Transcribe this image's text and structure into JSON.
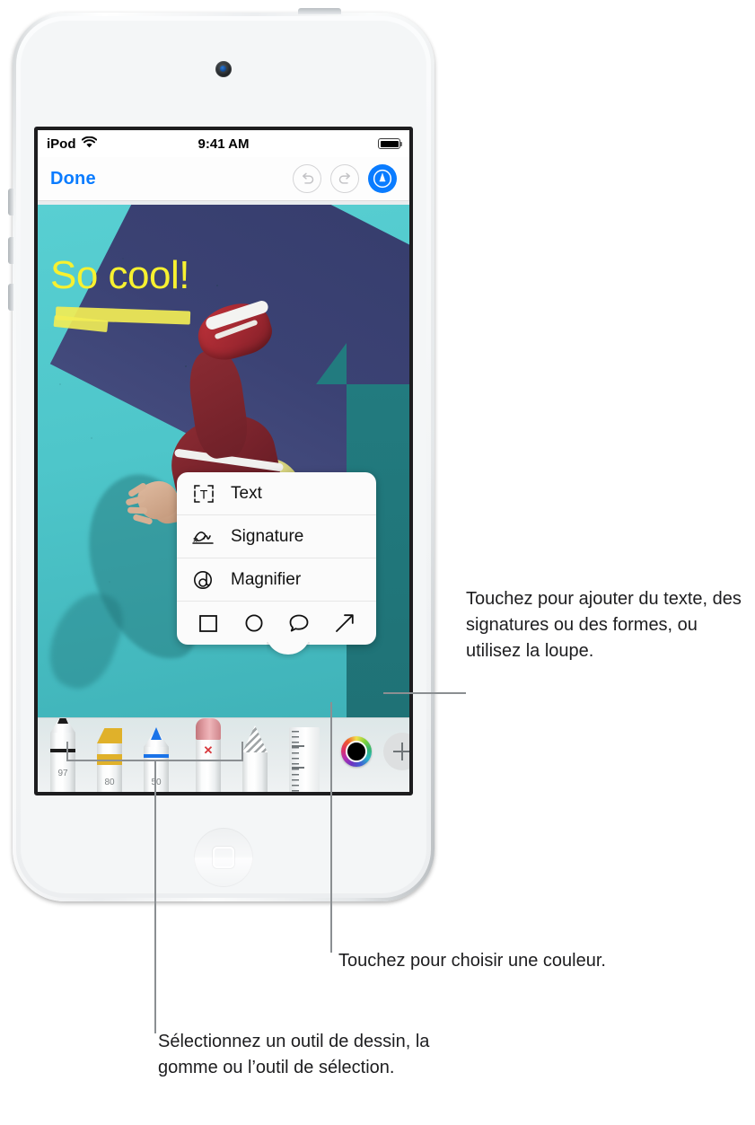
{
  "device": {
    "name": "iPod touch",
    "camera_icon": "front-camera",
    "home_button_icon": "home-button-icon"
  },
  "status_bar": {
    "carrier": "iPod",
    "wifi_icon": "wifi-icon",
    "time": "9:41 AM",
    "battery_icon": "battery-full-icon"
  },
  "nav_bar": {
    "done_label": "Done",
    "undo_icon": "undo-icon",
    "redo_icon": "redo-icon",
    "markup_icon": "markup-pen-icon",
    "markup_color": "#0a7cff"
  },
  "photo": {
    "annotation_text": "So cool!",
    "annotation_color": "#f7f130",
    "highlight_color": "#f2ed55"
  },
  "popup": {
    "items": [
      {
        "label": "Text",
        "icon": "text-box-icon"
      },
      {
        "label": "Signature",
        "icon": "signature-icon"
      },
      {
        "label": "Magnifier",
        "icon": "magnifier-icon"
      }
    ],
    "shapes": [
      {
        "icon": "square-shape-icon"
      },
      {
        "icon": "circle-shape-icon"
      },
      {
        "icon": "speech-bubble-shape-icon"
      },
      {
        "icon": "arrow-shape-icon"
      }
    ]
  },
  "toolbar": {
    "tools": [
      {
        "name": "pen-tool",
        "number": "97",
        "color": "#1b1b1b"
      },
      {
        "name": "highlighter-tool",
        "number": "80",
        "color": "#e0b12a"
      },
      {
        "name": "marker-tool",
        "number": "50",
        "color": "#1a73e8"
      },
      {
        "name": "eraser-tool",
        "number": "",
        "color": "#d98a8f"
      },
      {
        "name": "lasso-tool",
        "number": "",
        "color": "#9a9ea0"
      },
      {
        "name": "ruler-tool",
        "number": "",
        "color": "#d9dcdd"
      }
    ],
    "color_wheel_icon": "color-wheel-icon",
    "selected_color": "#000000",
    "add_button_icon": "plus-icon"
  },
  "callouts": {
    "magnifier": "Touchez pour ajouter du texte, des signatures ou des formes, ou utilisez la loupe.",
    "color": "Touchez pour choisir une couleur.",
    "tools": "Sélectionnez un outil de dessin, la gomme ou l’outil de sélection."
  }
}
